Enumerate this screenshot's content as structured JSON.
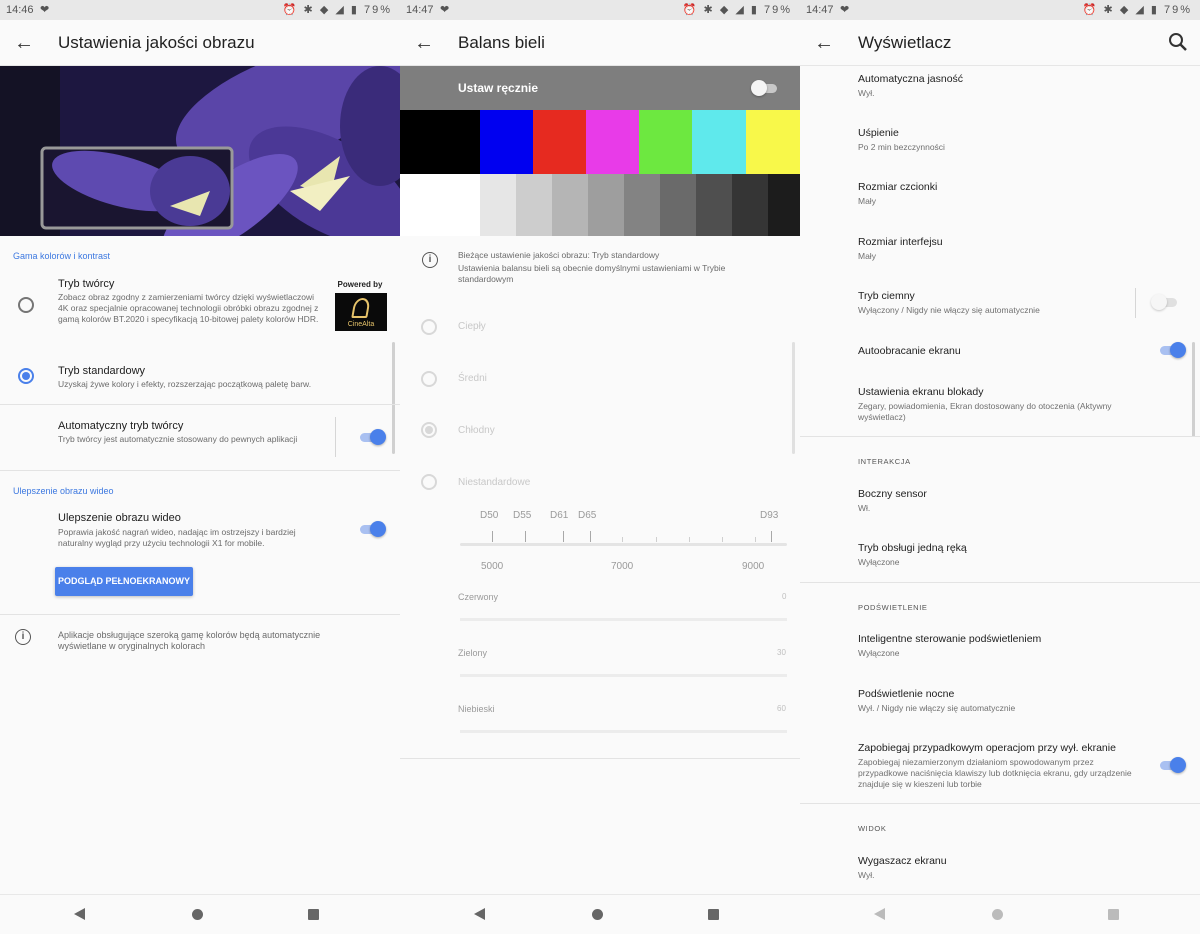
{
  "colors": {
    "accent": "#4a80ea",
    "toolbar_bg": "#fafafa",
    "statusbar_bg": "#e8e8e8",
    "wb_header": "#7e7e7e"
  },
  "status": {
    "time_1": "14:46",
    "time_2": "14:47",
    "time_3": "14:47",
    "battery": "79%"
  },
  "panel1": {
    "title": "Ustawienia jakości obrazu",
    "section_1": "Gama kolorów i kontrast",
    "creator_mode": {
      "title": "Tryb twórcy",
      "subtitle": "Zobacz obraz zgodny z zamierzeniami twórcy dzięki wyświetlaczowi 4K oraz specjalnie opracowanej technologii obróbki obrazu zgodnej z gamą kolorów BT.2020 i specyfikacją 10-bitowej palety kolorów HDR.",
      "badge_powered": "Powered by",
      "badge_brand": "CineAlta"
    },
    "standard_mode": {
      "title": "Tryb standardowy",
      "subtitle": "Uzyskaj żywe kolory i efekty, rozszerzając początkową paletę barw."
    },
    "auto_creator": {
      "title": "Automatyczny tryb twórcy",
      "subtitle": "Tryb twórcy jest automatycznie stosowany do pewnych aplikacji"
    },
    "section_2": "Ulepszenie obrazu wideo",
    "video_enhance": {
      "title": "Ulepszenie obrazu wideo",
      "subtitle": "Poprawia jakość nagrań wideo, nadając im ostrzejszy i bardziej naturalny wygląd przy użyciu technologii X1 for mobile."
    },
    "preview_button": "PODGLĄD PEŁNOEKRANOWY",
    "info_text": "Aplikacje obsługujące szeroką gamę kolorów będą automatycznie wyświetlane w oryginalnych kolorach"
  },
  "panel2": {
    "title": "Balans bieli",
    "manual_label": "Ustaw ręcznie",
    "color_bars_top": [
      "#000000",
      "#0000f0",
      "#e62a20",
      "#e83be8",
      "#6de840",
      "#5fe9ec",
      "#f8f84a"
    ],
    "color_bars_bottom": [
      "#ffffff",
      "#e6e6e6",
      "#cdcdcd",
      "#b5b5b5",
      "#9e9e9e",
      "#838383",
      "#6a6a6a",
      "#4f4f4f",
      "#353535",
      "#1c1c1c"
    ],
    "info_line1": "Bieżące ustawienie jakości obrazu: Tryb standardowy",
    "info_line2": "Ustawienia balansu bieli są obecnie domyślnymi ustawieniami w Trybie standardowym",
    "options": [
      "Ciepły",
      "Średni",
      "Chłodny",
      "Niestandardowe"
    ],
    "scale_top": [
      "D50",
      "D55",
      "D61",
      "D65",
      "D93"
    ],
    "scale_bottom": [
      "5000",
      "7000",
      "9000"
    ],
    "sliders": [
      {
        "label": "Czerwony",
        "value": "0"
      },
      {
        "label": "Zielony",
        "value": "30"
      },
      {
        "label": "Niebieski",
        "value": "60"
      }
    ]
  },
  "panel3": {
    "title": "Wyświetlacz",
    "items": [
      {
        "title": "Automatyczna jasność",
        "sub": "Wył."
      },
      {
        "title": "Uśpienie",
        "sub": "Po 2 min bezczynności"
      },
      {
        "title": "Rozmiar czcionki",
        "sub": "Mały"
      },
      {
        "title": "Rozmiar interfejsu",
        "sub": "Mały"
      },
      {
        "title": "Tryb ciemny",
        "sub": "Wyłączony / Nigdy nie włączy się automatycznie"
      },
      {
        "title": "Autoobracanie ekranu",
        "sub": ""
      },
      {
        "title": "Ustawienia ekranu blokady",
        "sub": "Zegary, powiadomienia, Ekran dostosowany do otoczenia (Aktywny wyświetlacz)"
      }
    ],
    "cat_interaction": "INTERAKCJA",
    "interaction_items": [
      {
        "title": "Boczny sensor",
        "sub": "Wł."
      },
      {
        "title": "Tryb obsługi jedną ręką",
        "sub": "Wyłączone"
      }
    ],
    "cat_backlight": "PODŚWIETLENIE",
    "backlight_items": [
      {
        "title": "Inteligentne sterowanie podświetleniem",
        "sub": "Wyłączone"
      },
      {
        "title": "Podświetlenie nocne",
        "sub": "Wył. / Nigdy nie włączy się automatycznie"
      },
      {
        "title": "Zapobiegaj przypadkowym operacjom przy wył. ekranie",
        "sub": "Zapobiegaj niezamierzonym działaniom spowodowanym przez przypadkowe naciśnięcia klawiszy lub dotknięcia ekranu, gdy urządzenie znajduje się w kieszeni lub torbie"
      }
    ],
    "cat_view": "WIDOK",
    "view_items": [
      {
        "title": "Wygaszacz ekranu",
        "sub": "Wył."
      }
    ]
  }
}
